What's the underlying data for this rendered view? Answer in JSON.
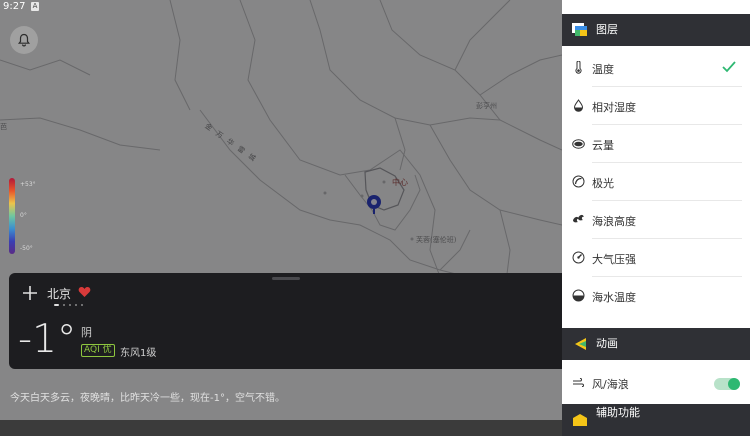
{
  "status_bar": {
    "time": "9:27",
    "badge": "A"
  },
  "map": {
    "labels": {
      "region_vertical": "金 万 华 雷 城",
      "city_marker": "中心",
      "town_east": "彭亨州",
      "town_south": "芙蓉(塞伦班)",
      "town_center": "雪兰莪",
      "town_west": "芭"
    },
    "legend": {
      "top": "+53°",
      "mid": "0°",
      "bottom": "-50°"
    }
  },
  "weather_card": {
    "city": "北京",
    "temperature": "-1°",
    "condition": "阴",
    "aqi": "AQI 优",
    "wind": "东风1级",
    "page_count": 5,
    "active_page": 0
  },
  "summary": "今天白天多云，夜晚晴，比昨天冷一些，现在-1°，空气不错。",
  "panel": {
    "layers_title": "图层",
    "layers": [
      {
        "label": "温度",
        "icon": "thermometer-icon",
        "selected": true
      },
      {
        "label": "相对湿度",
        "icon": "droplet-icon",
        "selected": false
      },
      {
        "label": "云量",
        "icon": "cloud-icon",
        "selected": false
      },
      {
        "label": "极光",
        "icon": "aurora-icon",
        "selected": false
      },
      {
        "label": "海浪高度",
        "icon": "wave-icon",
        "selected": false
      },
      {
        "label": "大气压强",
        "icon": "pressure-icon",
        "selected": false
      },
      {
        "label": "海水温度",
        "icon": "sea-temp-icon",
        "selected": false
      }
    ],
    "animation_title": "动画",
    "animation_items": [
      {
        "label": "风/海浪",
        "icon": "wind-icon",
        "enabled": true
      }
    ],
    "accessibility_title": "辅助功能"
  },
  "colors": {
    "accent_green": "#2eb872",
    "aqi_green": "#8ec63f",
    "header_bg": "#2f3035",
    "card_bg": "#1d1d20",
    "heart_red": "#d83a3a"
  }
}
